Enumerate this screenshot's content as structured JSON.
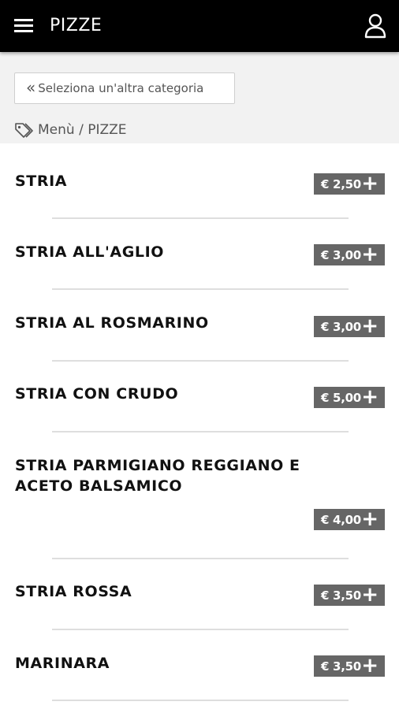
{
  "appbar": {
    "title": "PIZZE",
    "menu_icon": "hamburger-menu-icon",
    "user_icon": "user-account-icon"
  },
  "subheader": {
    "back_chevron": "«",
    "back_label": "Seleziona un'altra categoria",
    "breadcrumb_icon": "tag-icon",
    "breadcrumb": "Menù / PIZZE"
  },
  "items": [
    {
      "name": "STRIA",
      "price": "€ 2,50"
    },
    {
      "name": "STRIA ALL'AGLIO",
      "price": "€ 3,00"
    },
    {
      "name": "STRIA AL ROSMARINO",
      "price": "€ 3,00"
    },
    {
      "name": "STRIA CON CRUDO",
      "price": "€ 5,00"
    },
    {
      "name": "STRIA PARMIGIANO REGGIANO E ACETO BALSAMICO",
      "price": "€ 4,00"
    },
    {
      "name": "STRIA ROSSA",
      "price": "€ 3,50"
    },
    {
      "name": "MARINARA",
      "price": "€ 3,50"
    }
  ],
  "add_icon": "plus-icon",
  "colors": {
    "appbar_bg": "#000000",
    "price_bg": "#666666",
    "subheader_bg": "#f2f2f2"
  }
}
